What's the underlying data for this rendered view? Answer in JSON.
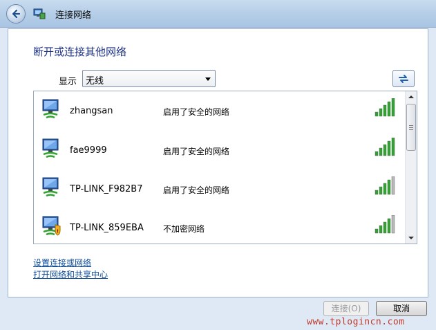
{
  "window": {
    "title": "连接网络"
  },
  "main": {
    "heading": "断开或连接其他网络",
    "show_label": "显示",
    "show_select_value": "无线"
  },
  "networks": [
    {
      "name": "zhangsan",
      "status": "启用了安全的网络",
      "secured": true,
      "signal_bars": 5
    },
    {
      "name": "fae9999",
      "status": "启用了安全的网络",
      "secured": true,
      "signal_bars": 5
    },
    {
      "name": "TP-LINK_F982B7",
      "status": "启用了安全的网络",
      "secured": true,
      "signal_bars": 4
    },
    {
      "name": "TP-LINK_859EBA",
      "status": "不加密网络",
      "secured": false,
      "signal_bars": 4
    }
  ],
  "links": {
    "setup_connection": "设置连接或网络",
    "open_network_center": "打开网络和共享中心"
  },
  "buttons": {
    "connect": "连接(O)",
    "cancel": "取消"
  },
  "watermark": "www.tplogincn.com",
  "colors": {
    "signal_active": "#2fa52f",
    "signal_inactive": "#b8b8b8",
    "heading": "#1e3287",
    "link": "#0e4c9c"
  }
}
